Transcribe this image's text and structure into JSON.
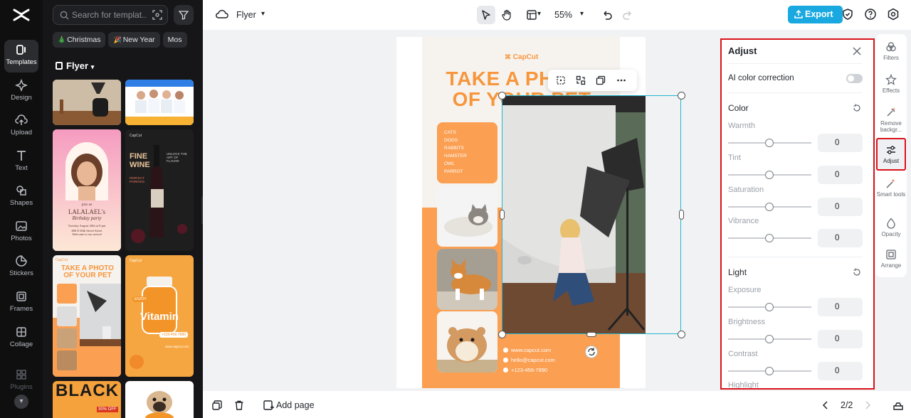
{
  "rail": {
    "items": [
      {
        "label": "Templates"
      },
      {
        "label": "Design"
      },
      {
        "label": "Upload"
      },
      {
        "label": "Text"
      },
      {
        "label": "Shapes"
      },
      {
        "label": "Photos"
      },
      {
        "label": "Stickers"
      },
      {
        "label": "Frames"
      },
      {
        "label": "Collage"
      },
      {
        "label": "Plugins"
      }
    ]
  },
  "panel": {
    "search_placeholder": "Search for templat...",
    "chips": [
      {
        "emoji": "🎄",
        "label": "Christmas"
      },
      {
        "emoji": "🎉",
        "label": "New Year"
      },
      {
        "emoji": "",
        "label": "Mos"
      }
    ],
    "category": "Flyer",
    "thumbs": {
      "lalala": {
        "line1": "join us",
        "line2": "LALALAEL's",
        "line3": "Birthday party",
        "line4": "Tuesday August 20th at 8 pm",
        "line5": "#06 E 60th Street Street",
        "line6": "Welcome to our arrival"
      },
      "wine": {
        "brand": "CapCut",
        "title": "FINE WINE",
        "sub": "PERFECT PAIRINGS",
        "side": "UNLOCK THE ART OF FLAVOR"
      },
      "pet": {
        "brand": "CapCut",
        "title": "TAKE A PHOTO OF YOUR PET"
      },
      "vitamin": {
        "brand": "CapCut",
        "badge": "ENJOY",
        "title": "Vitamin",
        "phone": "+123-456-7890",
        "url": "www.capcut.com"
      },
      "black": {
        "title": "BLACK",
        "sub": "30% OFF"
      }
    }
  },
  "topbar": {
    "doc_name": "Flyer",
    "zoom": "55%",
    "export_label": "Export"
  },
  "canvas": {
    "brand": "CapCut",
    "headline_1": "TAKE A PHOTO",
    "headline_2": "OF YOUR PET",
    "list": [
      "CATS",
      "DOGS",
      "RABBITS",
      "HAMSTER",
      "OWL",
      "PARROT"
    ],
    "contacts": [
      "www.capcut.com",
      "hello@capcut.com",
      "+123-456-7890"
    ]
  },
  "adjust": {
    "title": "Adjust",
    "ai_label": "AI color correction",
    "ai_enabled": false,
    "color_section": "Color",
    "light_section": "Light",
    "color_sliders": [
      {
        "label": "Warmth",
        "value": "0"
      },
      {
        "label": "Tint",
        "value": "0"
      },
      {
        "label": "Saturation",
        "value": "0"
      },
      {
        "label": "Vibrance",
        "value": "0"
      }
    ],
    "light_sliders": [
      {
        "label": "Exposure",
        "value": "0"
      },
      {
        "label": "Brightness",
        "value": "0"
      },
      {
        "label": "Contrast",
        "value": "0"
      },
      {
        "label": "Highlight",
        "value": ""
      }
    ]
  },
  "rtools": [
    {
      "label": "Filters"
    },
    {
      "label": "Effects"
    },
    {
      "label": "Remove backgr..."
    },
    {
      "label": "Adjust"
    },
    {
      "label": "Smart tools"
    },
    {
      "label": "Opacity"
    },
    {
      "label": "Arrange"
    }
  ],
  "bottombar": {
    "add_page": "Add page",
    "page_count": "2/2"
  },
  "colors": {
    "accent": "#19a9e0",
    "highlight_border": "#d9121a",
    "selection": "#22b7d1",
    "flyer_orange": "#f7963c"
  }
}
